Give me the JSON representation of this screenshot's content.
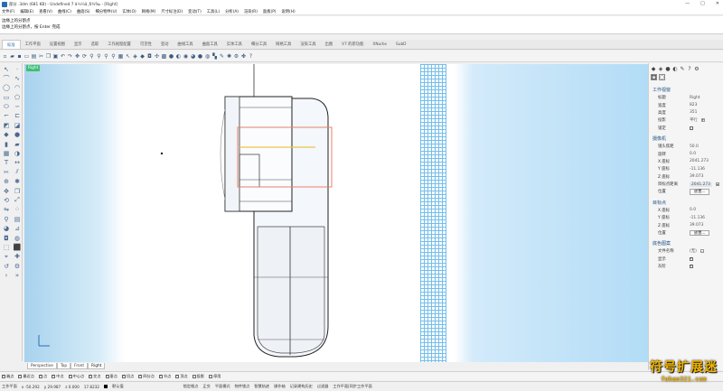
{
  "titlebar": {
    "title": "部分 .3dm (681 KB) - Undefined 7 â¼¼ä¸å¾‰ - [Right]",
    "minimize": "—",
    "maximize": "□",
    "close": "✕"
  },
  "menu": [
    "文件(F)",
    "编辑(E)",
    "查看(V)",
    "曲线(C)",
    "曲面(S)",
    "细分物件(U)",
    "实体(O)",
    "网格(M)",
    "尺寸标注(D)",
    "变动(T)",
    "工具(L)",
    "分析(A)",
    "渲染(R)",
    "面板(P)",
    "说明(H)"
  ],
  "command": {
    "line1": "边缘上的分割点",
    "line2": "边缘上的分割点，按 Enter 完成"
  },
  "tabs": [
    "标准",
    "工作平面",
    "设置视图",
    "显示",
    "选取",
    "工作视窗配置",
    "可见性",
    "变动",
    "曲线工具",
    "曲面工具",
    "实体工具",
    "细分工具",
    "网格工具",
    "渲染工具",
    "出图",
    "V7 的新功能",
    "XNurbs",
    "SubD"
  ],
  "toolbar_icons": [
    "new-icon",
    "open-icon",
    "save-icon",
    "print-icon",
    "import-icon",
    "cut-icon",
    "copy-icon",
    "paste-icon",
    "undo-icon",
    "redo-icon",
    "pan-icon",
    "rotate-icon",
    "zoom-icon",
    "zoom-window-icon",
    "zoom-extents-icon",
    "zoom-selected-icon",
    "grid-icon",
    "select-icon",
    "layers-icon",
    "car-icon",
    "lock-icon",
    "move-icon",
    "box-icon",
    "sphere-icon",
    "light-icon",
    "properties-icon",
    "render-icon",
    "material-icon",
    "environment-icon",
    "texture-icon",
    "analyze-icon",
    "globe-icon",
    "settings-icon",
    "puzzle-icon",
    "help-icon"
  ],
  "viewport": {
    "label": "Right",
    "tabs": [
      "Perspective",
      "Top",
      "Front",
      "Right"
    ],
    "active_tab": "Right"
  },
  "osnaps": [
    {
      "label": "端点",
      "checked": true
    },
    {
      "label": "最近点",
      "checked": true
    },
    {
      "label": "点",
      "checked": true
    },
    {
      "label": "中点",
      "checked": true
    },
    {
      "label": "中心点",
      "checked": true
    },
    {
      "label": "交点",
      "checked": true
    },
    {
      "label": "垂点",
      "checked": true
    },
    {
      "label": "切点",
      "checked": true
    },
    {
      "label": "四分点",
      "checked": true
    },
    {
      "label": "节点",
      "checked": true
    },
    {
      "label": "顶点",
      "checked": true
    },
    {
      "label": "投影",
      "checked": false
    },
    {
      "label": "停用",
      "checked": false
    }
  ],
  "status": {
    "cplane": "工作平面",
    "x": "x -50.292",
    "y": "y 29.987",
    "z": "z 0.000",
    "unit": "17.8232",
    "layer": "默认值",
    "items": [
      "锁定格点",
      "正交",
      "平面模式",
      "物件锁点",
      "智慧轨迹",
      "操作轴",
      "记录建构历史",
      "过滤器",
      "工作平面|同步工作平面"
    ]
  },
  "panel": {
    "section_viewport": "工作视窗",
    "title_k": "标题",
    "title_v": "Right",
    "width_k": "宽度",
    "width_v": "823",
    "height_k": "高度",
    "height_v": "351",
    "proj_k": "投影",
    "proj_v": "平行",
    "lock_k": "锁定",
    "section_camera": "摄像机",
    "lens_k": "镜头焦距",
    "lens_v": "50.0",
    "rot_k": "旋转",
    "rot_v": "0.0",
    "cx_k": "X 座标",
    "cx_v": "2041.273",
    "cy_k": "Y 座标",
    "cy_v": "-11.136",
    "cz_k": "Z 座标",
    "cz_v": "39.073",
    "dist_k": "目标点距离",
    "dist_v": "2041.273",
    "pos_k": "位置",
    "pos_btn": "放置...",
    "section_target": "目标点",
    "tx_k": "X 座标",
    "tx_v": "0.0",
    "ty_k": "Y 座标",
    "ty_v": "-11.136",
    "tz_k": "Z 座标",
    "tz_v": "39.073",
    "tpos_k": "位置",
    "tpos_btn": "放置...",
    "section_wallpaper": "底色图案",
    "file_k": "文件名称",
    "file_v": "(无)",
    "show_k": "显示",
    "gray_k": "灰阶"
  },
  "watermark": {
    "cn": "符号扩展迷",
    "url": "fuhao321.com"
  },
  "colors": {
    "accent": "#2a6eb8",
    "viewport_label": "#3fbf6f",
    "selection": "#e8806a",
    "highlight": "#e8c74a"
  }
}
